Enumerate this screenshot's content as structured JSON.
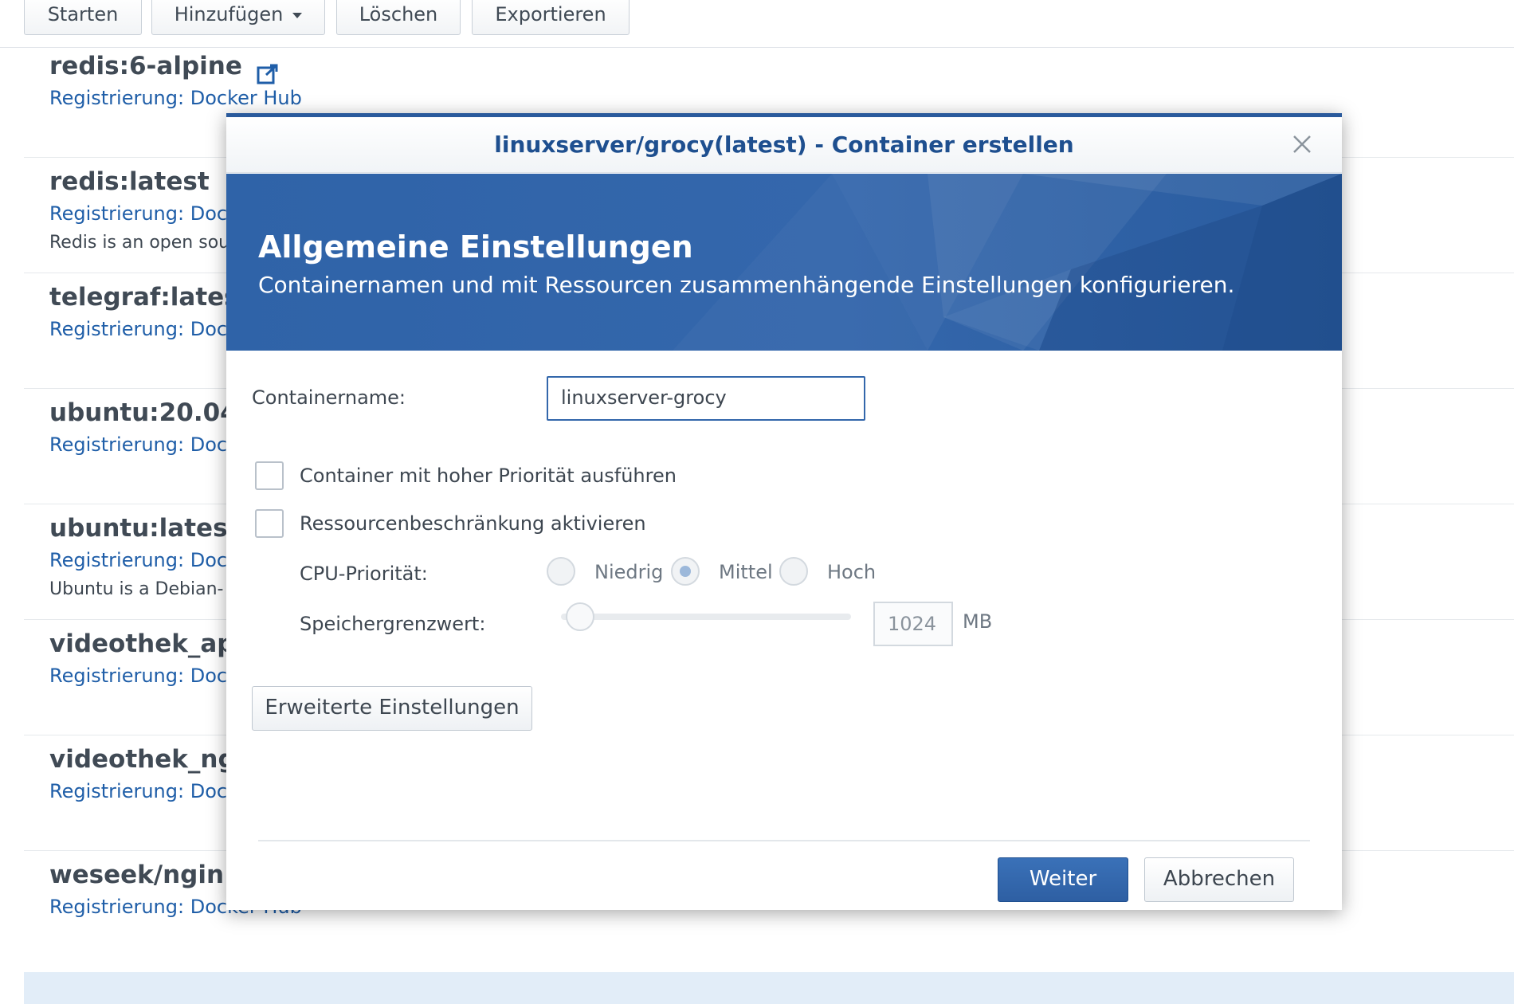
{
  "toolbar": {
    "start_label": "Starten",
    "add_label": "Hinzufügen",
    "delete_label": "Löschen",
    "export_label": "Exportieren"
  },
  "images": [
    {
      "name": "redis:6-alpine",
      "registry": "Registrierung: Docker Hub",
      "description": ""
    },
    {
      "name": "redis:latest",
      "registry": "Registrierung: Doc",
      "description": "Redis is an open sou"
    },
    {
      "name": "telegraf:lates",
      "registry": "Registrierung: Doc",
      "description": ""
    },
    {
      "name": "ubuntu:20.04",
      "registry": "Registrierung: Doc",
      "description": ""
    },
    {
      "name": "ubuntu:latest",
      "registry": "Registrierung: Doc",
      "description": "Ubuntu is a Debian-"
    },
    {
      "name": "videothek_ap",
      "registry": "Registrierung: Doc",
      "description": ""
    },
    {
      "name": "videothek_ng",
      "registry": "Registrierung: Doc",
      "description": ""
    },
    {
      "name": "weseek/ngin",
      "registry": "Registrierung: Docker Hub",
      "description": ""
    }
  ],
  "modal": {
    "title": "linuxserver/grocy(latest) - Container erstellen",
    "banner_title": "Allgemeine Einstellungen",
    "banner_subtitle": "Containernamen und mit Ressourcen zusammenhängende Einstellungen konfigurieren.",
    "container_name_label": "Containername:",
    "container_name_value": "linuxserver-grocy",
    "high_priority_label": "Container mit hoher Priorität ausführen",
    "resource_limit_label": "Ressourcenbeschränkung aktivieren",
    "cpu_priority_label": "CPU-Priorität:",
    "cpu_options": [
      "Niedrig",
      "Mittel",
      "Hoch"
    ],
    "cpu_selected": "Mittel",
    "memory_label": "Speichergrenzwert:",
    "memory_value": "1024",
    "memory_unit": "MB",
    "advanced_label": "Erweiterte Einstellungen",
    "next_label": "Weiter",
    "cancel_label": "Abbrechen"
  },
  "colors": {
    "accent": "#2e5fa3",
    "link": "#1f5ea8",
    "title_blue": "#1e4f8f"
  }
}
